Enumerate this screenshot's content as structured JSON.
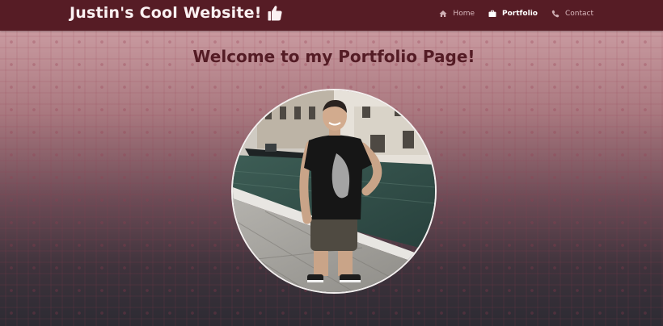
{
  "navbar": {
    "brand_title": "Justin's Cool Website!",
    "brand_icon": "thumbs-up-icon",
    "items": [
      {
        "label": "Home",
        "icon": "home-icon",
        "active": false
      },
      {
        "label": "Portfolio",
        "icon": "briefcase-icon",
        "active": true
      },
      {
        "label": "Contact",
        "icon": "phone-icon",
        "active": false
      }
    ]
  },
  "main": {
    "title": "Welcome to my Portfolio Page!"
  },
  "colors": {
    "nav_background": "#561c25",
    "title_color": "#541c25",
    "gradient_top": "#c99aa0",
    "gradient_bottom": "#2c2b33"
  }
}
